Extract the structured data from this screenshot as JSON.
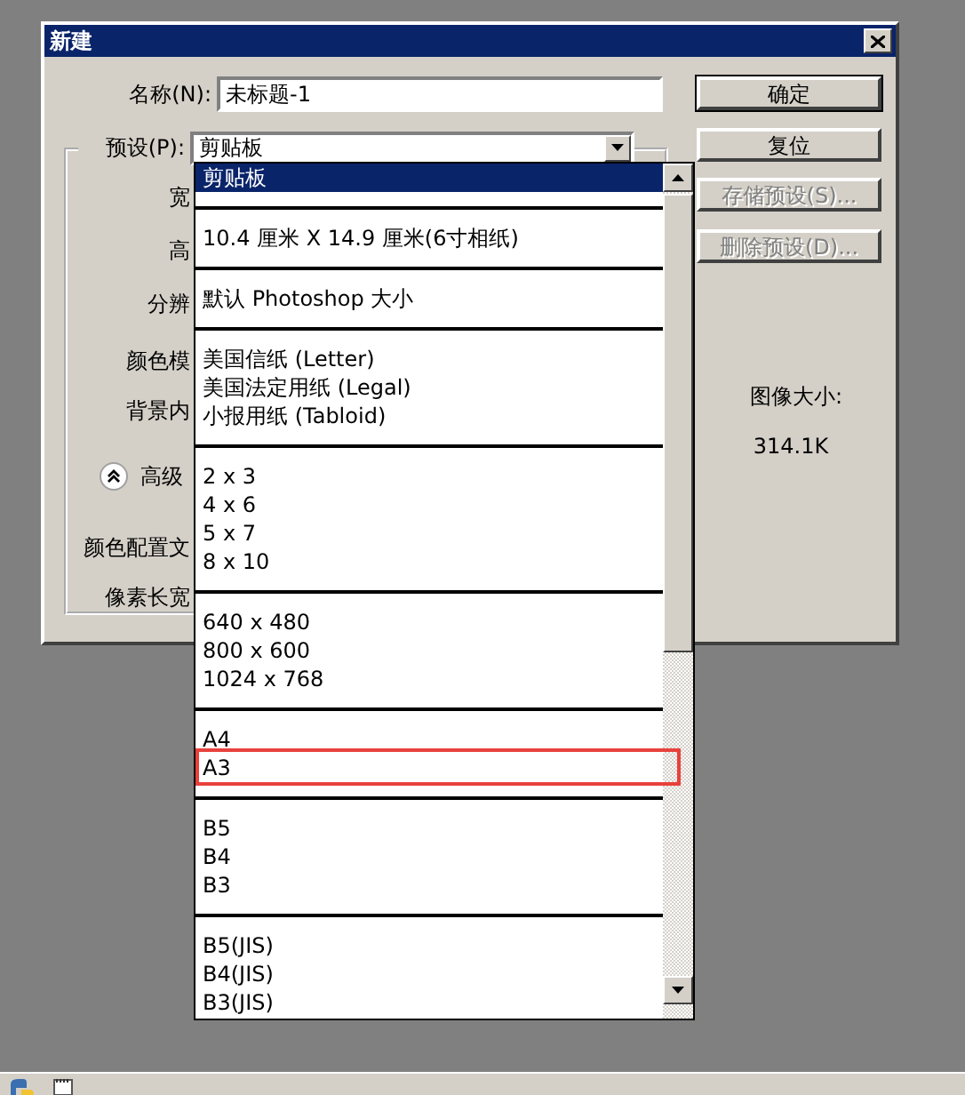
{
  "window": {
    "title": "新建"
  },
  "name_field": {
    "label": "名称(N):",
    "value": "未标题-1"
  },
  "preset": {
    "label": "预设(P):",
    "value": "剪贴板"
  },
  "field_labels": [
    {
      "kind": "label",
      "text": "宽"
    },
    {
      "kind": "label",
      "text": "高"
    },
    {
      "kind": "label",
      "text": "分辨"
    },
    {
      "kind": "label",
      "text": "颜色模"
    },
    {
      "kind": "label",
      "text": "背景内"
    },
    {
      "kind": "toggle",
      "text": "高级",
      "expanded": true
    },
    {
      "kind": "label",
      "text": "颜色配置文"
    },
    {
      "kind": "label",
      "text": "像素长宽"
    }
  ],
  "buttons": [
    {
      "label": "确定",
      "default": true,
      "disabled": false
    },
    {
      "label": "复位",
      "default": false,
      "disabled": false
    },
    {
      "label": "存储预设(S)...",
      "default": false,
      "disabled": true
    },
    {
      "label": "删除预设(D)...",
      "default": false,
      "disabled": true
    }
  ],
  "image_size": {
    "label": "图像大小:",
    "value": "314.1K"
  },
  "preset_list": [
    {
      "items": [
        {
          "label": "剪贴板",
          "selected": true,
          "marked": false
        }
      ]
    },
    {
      "items": [
        {
          "label": "10.4 厘米 X 14.9 厘米(6寸相纸)",
          "selected": false,
          "marked": false
        }
      ]
    },
    {
      "items": [
        {
          "label": "默认 Photoshop 大小",
          "selected": false,
          "marked": false
        }
      ]
    },
    {
      "items": [
        {
          "label": "美国信纸 (Letter)",
          "selected": false,
          "marked": false
        },
        {
          "label": "美国法定用纸 (Legal)",
          "selected": false,
          "marked": false
        },
        {
          "label": "小报用纸 (Tabloid)",
          "selected": false,
          "marked": false
        }
      ]
    },
    {
      "items": [
        {
          "label": "2 x 3",
          "selected": false,
          "marked": false
        },
        {
          "label": "4 x 6",
          "selected": false,
          "marked": false
        },
        {
          "label": "5 x 7",
          "selected": false,
          "marked": false
        },
        {
          "label": "8 x 10",
          "selected": false,
          "marked": false
        }
      ]
    },
    {
      "items": [
        {
          "label": "640 x 480",
          "selected": false,
          "marked": false
        },
        {
          "label": "800 x 600",
          "selected": false,
          "marked": false
        },
        {
          "label": "1024 x 768",
          "selected": false,
          "marked": false
        }
      ]
    },
    {
      "items": [
        {
          "label": "A4",
          "selected": false,
          "marked": false
        },
        {
          "label": "A3",
          "selected": false,
          "marked": true
        }
      ]
    },
    {
      "items": [
        {
          "label": "B5",
          "selected": false,
          "marked": false
        },
        {
          "label": "B4",
          "selected": false,
          "marked": false
        },
        {
          "label": "B3",
          "selected": false,
          "marked": false
        }
      ]
    },
    {
      "items": [
        {
          "label": "B5(JIS)",
          "selected": false,
          "marked": false
        },
        {
          "label": "B4(JIS)",
          "selected": false,
          "marked": false
        },
        {
          "label": "B3(JIS)",
          "selected": false,
          "marked": false
        }
      ]
    }
  ]
}
